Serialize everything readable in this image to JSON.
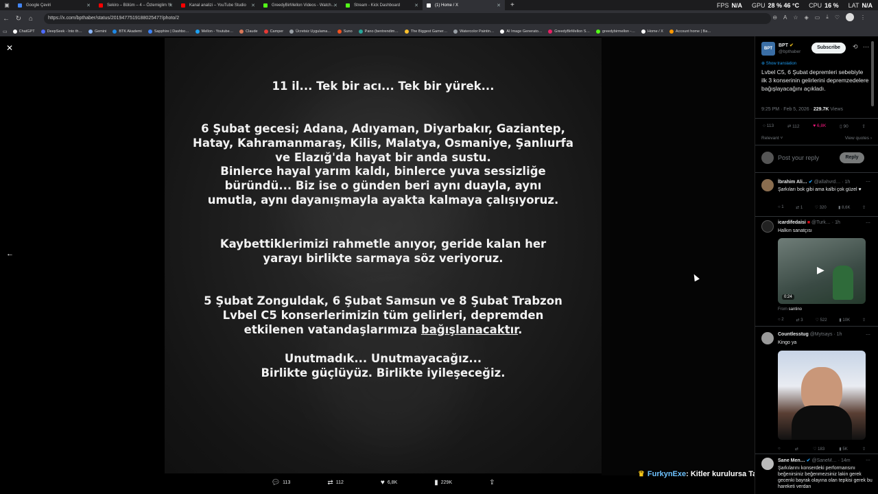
{
  "browser": {
    "tabs": [
      {
        "label": "Google Çeviri",
        "color": "#4285f4"
      },
      {
        "label": "Sekiro – Bölüm – 4 – Özlemiglim !!!",
        "color": "#ff0000"
      },
      {
        "label": "Kanal analizi – YouTube Studio",
        "color": "#ff0000"
      },
      {
        "label": "GreedyBirMellon Videos - Watch…",
        "color": "#53fc18"
      },
      {
        "label": "Stream - Kick Dashboard",
        "color": "#53fc18"
      },
      {
        "label": "(1) Home / X",
        "color": "#ffffff"
      }
    ],
    "new_tab": "+",
    "stats": {
      "fps_label": "FPS",
      "fps_value": "N/A",
      "gpu_label": "GPU",
      "gpu_value": "28 % 46 °C",
      "cpu_label": "CPU",
      "cpu_value": "16 %",
      "lat_label": "LAT",
      "lat_value": "N/A"
    },
    "url": "https://x.com/bpthaber/status/2019477519188025477/photo/2",
    "bookmarks": [
      {
        "label": "ChatGPT",
        "color": "#ffffff"
      },
      {
        "label": "DeepSeek - Into th…",
        "color": "#4d6bfe"
      },
      {
        "label": "Gemini",
        "color": "#8ab4f8"
      },
      {
        "label": "BTK Akademi",
        "color": "#1e88e5"
      },
      {
        "label": "Sapphire | Dashbo…",
        "color": "#3b82f6"
      },
      {
        "label": "Mellon - Youtube…",
        "color": "#1da1f2"
      },
      {
        "label": "Claude",
        "color": "#d97757"
      },
      {
        "label": "Camper",
        "color": "#e53935"
      },
      {
        "label": "Ücretsiz Uygulama…",
        "color": "#9aa0a6"
      },
      {
        "label": "Suno",
        "color": "#f4511e"
      },
      {
        "label": "Pano (bentrendim…",
        "color": "#26a69a"
      },
      {
        "label": "The Biggest Gamer…",
        "color": "#fbc02d"
      },
      {
        "label": "Watercolor Paintin…",
        "color": "#9aa0a6"
      },
      {
        "label": "AI Image Generato…",
        "color": "#ffffff"
      },
      {
        "label": "GreedyBirMellon S…",
        "color": "#e91e63"
      },
      {
        "label": "greedybirmellon -…",
        "color": "#53fc18"
      },
      {
        "label": "Home / X",
        "color": "#ffffff"
      },
      {
        "label": "Account home | Ba…",
        "color": "#ff9800"
      }
    ]
  },
  "viewer": {
    "close_icon": "close-icon",
    "prev_icon": "arrow-left-icon",
    "expand_icon": "double-chevron-icon",
    "photo_text": {
      "line1": "11 il... Tek bir acı... Tek bir yürek...",
      "para2": "6 Şubat gecesi; Adana, Adıyaman, Diyarbakır, Gaziantep, Hatay, Kahramanmaraş, Kilis, Malatya, Osmaniye, Şanlıurfa ve Elazığ'da hayat bir anda sustu.",
      "para3": "Binlerce hayal yarım kaldı, binlerce yuva sessizliğe büründü... Biz ise o günden beri aynı duayla, aynı umutla, aynı dayanışmayla ayakta kalmaya çalışıyoruz.",
      "para4": "Kaybettiklerimizi rahmetle anıyor, geride kalan her yarayı birlikte sarmaya söz veriyoruz.",
      "para5": "5 Şubat Zonguldak, 6 Şubat Samsun ve 8 Şubat Trabzon Lvbel C5 konserlerimizin tüm gelirleri, depremden etkilenen vatandaşlarımıza",
      "para5_underlined": "bağışlanacaktır",
      "para5_end": ".",
      "para6a": "Unutmadık... Unutmayacağız...",
      "para6b": "Birlikte güçlüyüz. Birlikte iyileşeceğiz."
    },
    "actions": {
      "replies": "113",
      "reposts": "112",
      "likes": "6,8K",
      "views": "229K"
    },
    "overlay": {
      "name": "FurkynExe",
      "message": ": Kitler kurulursa Tavşanın kedidendir"
    }
  },
  "sidebar": {
    "author_avatar": "BPT",
    "author_name": "BPT",
    "author_handle": "@bpthaber",
    "subscribe_label": "Subscribe",
    "translate_label": "Show translation",
    "post_text": "Lvbel C5, 6 Şubat depremleri sebebiyle ilk 3 konserinin gelirlerini depremzedelere bağışlayacağını açıkladı.",
    "post_time": "9:25 PM · Feb 5, 2026 · ",
    "post_views": "229.7K",
    "post_views_label": " Views",
    "stats": {
      "replies": "113",
      "reposts": "112",
      "likes": "6,8K",
      "bookmarks": "90"
    },
    "sort_label": "Relevant",
    "quotes_label": "View quotes",
    "reply_placeholder": "Post your reply",
    "reply_button": "Reply",
    "replies": [
      {
        "name": "İbrahim Ali…",
        "handle": "@allahvrd… · 1h",
        "text": "Şarkıları bok gibi ama kalbi çok güzel ♥",
        "stats": [
          "1",
          "1",
          "320",
          "8,6K"
        ]
      },
      {
        "name": "icardifedaisi",
        "handle": "@Turk… · 1h",
        "text": "Halkın sanatçısı",
        "duration": "0:24",
        "from_label": "From ",
        "from_name": "santino",
        "stats": [
          "2",
          "3",
          "522",
          "10K"
        ]
      },
      {
        "name": "Countlesstug",
        "handle": "@Mytsays · 1h",
        "text": "Kingo ya",
        "stats": [
          "",
          "",
          "183",
          "5K"
        ]
      },
      {
        "name": "Sane Men…",
        "handle": "@SaneM… · 14m",
        "text": "Şarkılarını konserdeki performansını beğenirsiniz beğenmezsiniz lakin gerek gecenki bayrak olayına olan tepkisi gerek bu hareketi verdan"
      }
    ]
  }
}
